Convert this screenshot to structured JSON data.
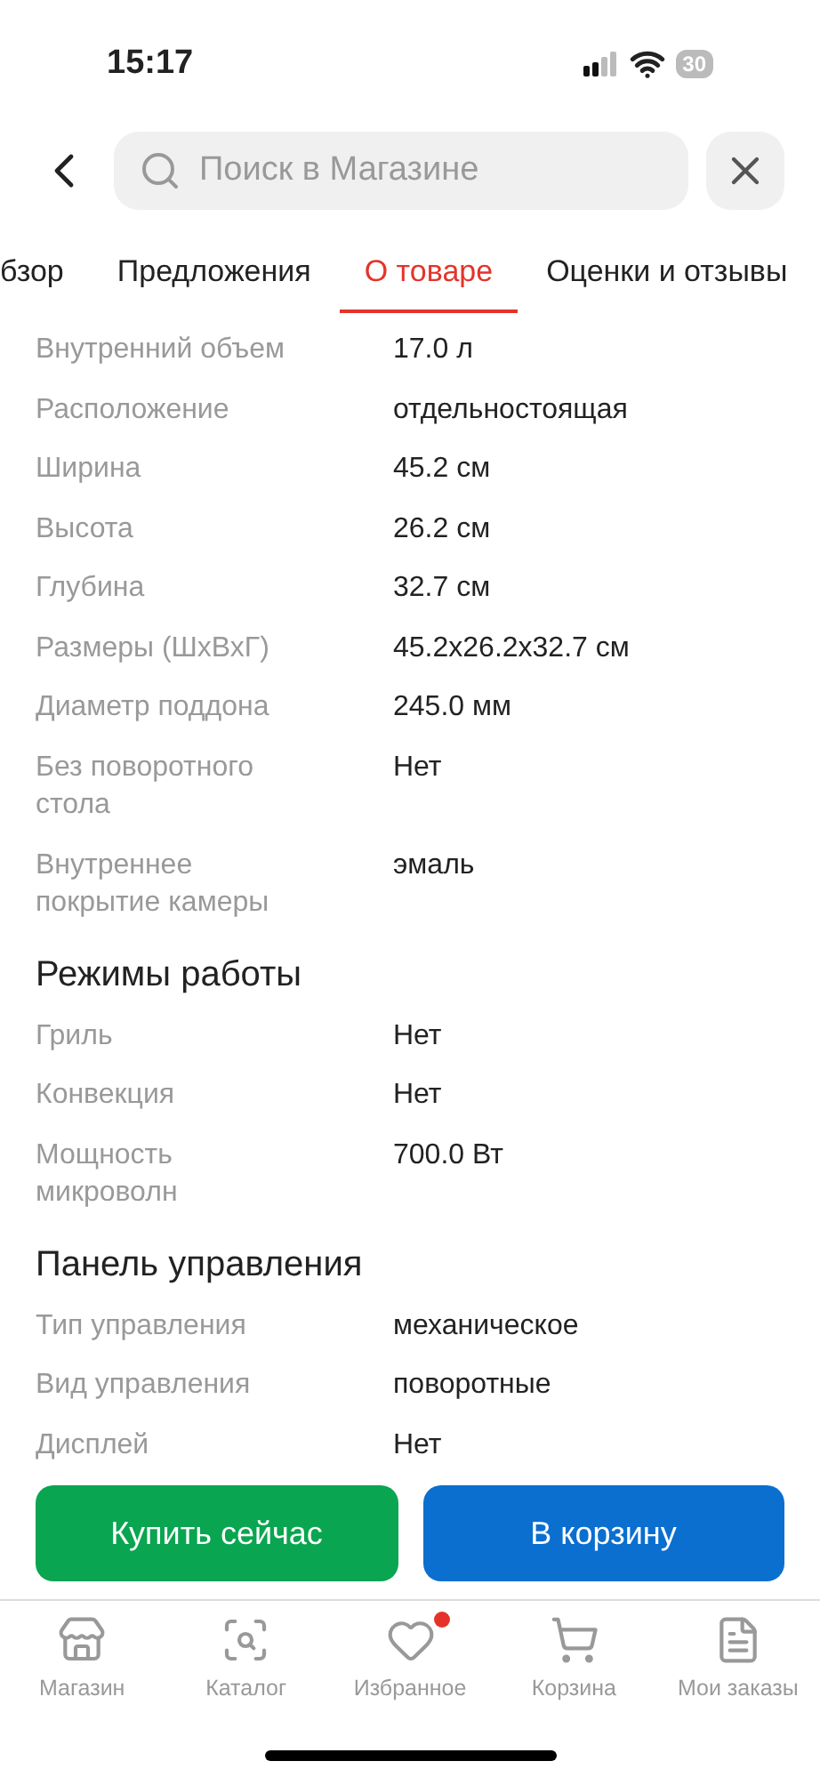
{
  "status_bar": {
    "time": "15:17",
    "battery": "30"
  },
  "search": {
    "placeholder": "Поиск в Магазине"
  },
  "tabs": [
    {
      "label": "бзор",
      "selected": false
    },
    {
      "label": "Предложения",
      "selected": false
    },
    {
      "label": "О товаре",
      "selected": true
    },
    {
      "label": "Оценки и отзывы",
      "selected": false
    }
  ],
  "sections": [
    {
      "rows": [
        {
          "label": "Внутренний объем",
          "value": "17.0 л"
        },
        {
          "label": "Расположение",
          "value": "отдельностоящая"
        },
        {
          "label": "Ширина",
          "value": "45.2 см"
        },
        {
          "label": "Высота",
          "value": "26.2 см"
        },
        {
          "label": "Глубина",
          "value": "32.7 см"
        },
        {
          "label": "Размеры (ШхВхГ)",
          "value": "45.2x26.2x32.7 см"
        },
        {
          "label": "Диаметр поддона",
          "value": "245.0 мм"
        },
        {
          "label": "Без поворотного\nстола",
          "value": "Нет"
        },
        {
          "label": "Внутреннее\nпокрытие камеры",
          "value": "эмаль"
        }
      ]
    },
    {
      "title": "Режимы работы",
      "rows": [
        {
          "label": "Гриль",
          "value": "Нет"
        },
        {
          "label": "Конвекция",
          "value": "Нет"
        },
        {
          "label": "Мощность\nмикроволн",
          "value": "700.0 Вт"
        }
      ]
    },
    {
      "title": "Панель управления",
      "rows": [
        {
          "label": "Тип управления",
          "value": "механическое"
        },
        {
          "label": "Вид управления",
          "value": "поворотные"
        },
        {
          "label": "Дисплей",
          "value": "Нет"
        }
      ]
    }
  ],
  "actions": [
    {
      "label": "Купить сейчас",
      "kind": "buy"
    },
    {
      "label": "В корзину",
      "kind": "cart"
    }
  ],
  "nav": [
    {
      "label": "Магазин",
      "kind": "store",
      "badge": false
    },
    {
      "label": "Каталог",
      "kind": "catalog",
      "badge": false
    },
    {
      "label": "Избранное",
      "kind": "favorites",
      "badge": true
    },
    {
      "label": "Корзина",
      "kind": "cart",
      "badge": false
    },
    {
      "label": "Мои заказы",
      "kind": "orders",
      "badge": false
    }
  ]
}
